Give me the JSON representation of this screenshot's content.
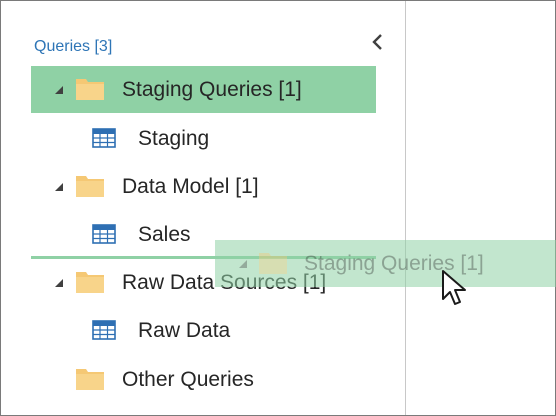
{
  "queries_pane": {
    "header": "Queries [3]",
    "collapse_button": "chevron-left-icon",
    "items": [
      {
        "label": "Staging Queries [1]",
        "icon": "folder-icon",
        "expander": "expand-triangle-icon",
        "selected": true
      },
      {
        "label": "Staging",
        "icon": "table-icon"
      },
      {
        "label": "Data Model [1]",
        "icon": "folder-icon",
        "expander": "expand-triangle-icon"
      },
      {
        "label": "Sales",
        "icon": "table-icon"
      },
      {
        "label": "Raw Data Sources [1]",
        "icon": "folder-icon",
        "expander": "expand-triangle-icon"
      },
      {
        "label": "Raw Data",
        "icon": "table-icon"
      },
      {
        "label": "Other Queries",
        "icon": "folder-icon"
      }
    ]
  },
  "drag_ghost": {
    "label": "Staging Queries [1]",
    "icon": "folder-icon"
  },
  "colors": {
    "header_text": "#2e75b6",
    "selection": "#8fd1a5",
    "folder": "#f5c874",
    "table_icon": "#2e6fb3"
  }
}
